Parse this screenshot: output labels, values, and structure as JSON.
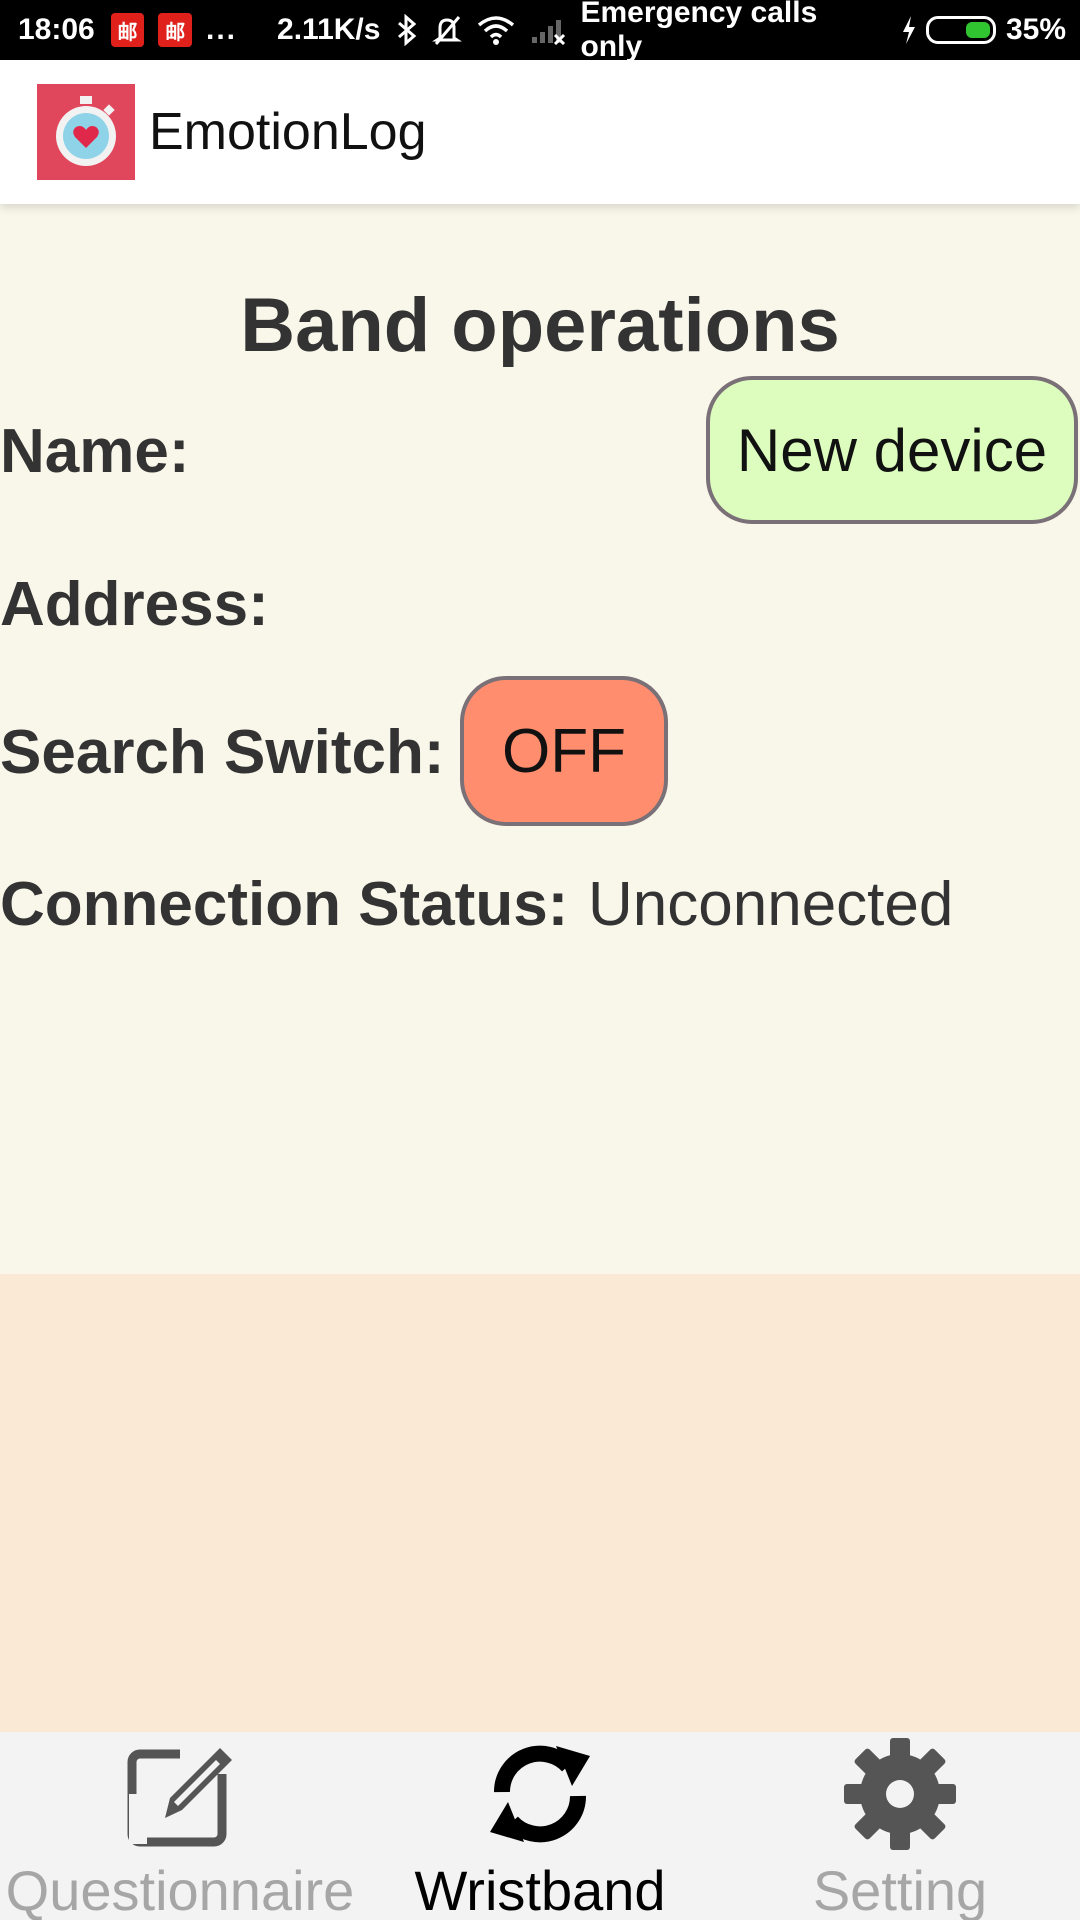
{
  "status_bar": {
    "time": "18:06",
    "badge1": "邮",
    "badge2": "邮",
    "more": "...",
    "speed": "2.11K/s",
    "carrier": "Emergency calls only",
    "battery": "35%",
    "battery_level": 0.35
  },
  "app_bar": {
    "title": "EmotionLog",
    "logo_icon": "stopwatch-heart-icon"
  },
  "main": {
    "title": "Band operations",
    "name_label": "Name:",
    "name_value": "New device",
    "address_label": "Address:",
    "search_label": "Search Switch:",
    "search_value": "OFF",
    "connection_label": "Connection Status:",
    "connection_value": "Unconnected"
  },
  "colors": {
    "name_pill": "#dcfdbd",
    "off_pill": "#ff8d6e",
    "content_bg": "#f9f6ea",
    "lower_bg": "#f9e9d5",
    "logo_bg": "#e0475c"
  },
  "bottom_nav": {
    "items": [
      {
        "label": "Questionnaire",
        "icon": "edit-icon",
        "active": false
      },
      {
        "label": "Wristband",
        "icon": "sync-icon",
        "active": true
      },
      {
        "label": "Setting",
        "icon": "gear-icon",
        "active": false
      }
    ]
  }
}
